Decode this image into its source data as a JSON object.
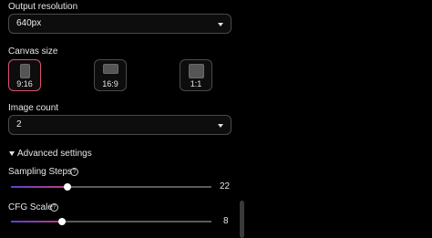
{
  "output_resolution": {
    "label": "Output resolution",
    "value": "640px"
  },
  "canvas_size": {
    "label": "Canvas size",
    "options": [
      {
        "label": "9:16",
        "selected": true
      },
      {
        "label": "16:9",
        "selected": false
      },
      {
        "label": "1:1",
        "selected": false
      }
    ],
    "selected_color": "#d9536f"
  },
  "image_count": {
    "label": "Image count",
    "value": "2"
  },
  "advanced": {
    "label": "Advanced settings",
    "expanded": true
  },
  "sampling_steps": {
    "label": "Sampling Steps",
    "value": "22",
    "help_icon": "?"
  },
  "cfg_scale": {
    "label": "CFG Scale",
    "value": "8",
    "help_icon": "?"
  },
  "colors": {
    "background": "#000000",
    "slider_gradient_start": "#5a3fd6",
    "slider_gradient_end": "#c03f80"
  }
}
